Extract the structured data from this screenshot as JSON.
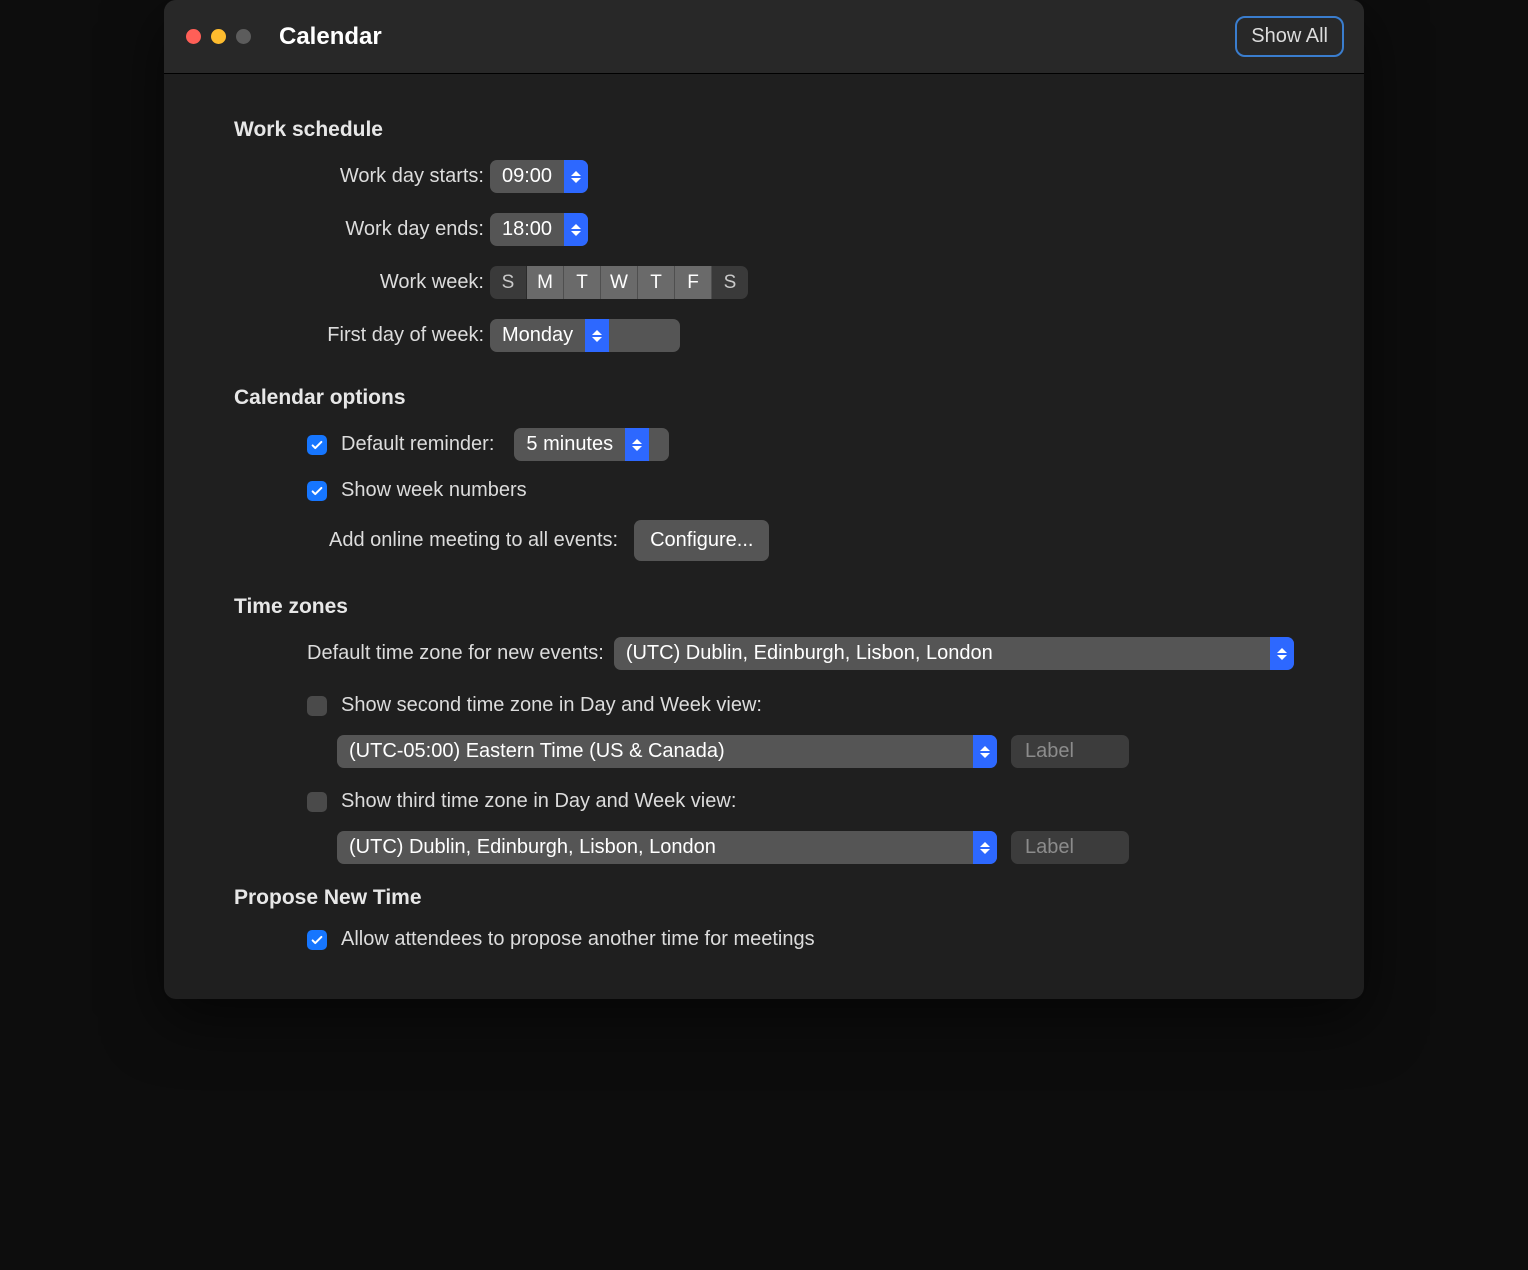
{
  "header": {
    "title": "Calendar",
    "show_all": "Show All"
  },
  "work_schedule": {
    "heading": "Work schedule",
    "starts_label": "Work day starts:",
    "starts_value": "09:00",
    "ends_label": "Work day ends:",
    "ends_value": "18:00",
    "week_label": "Work week:",
    "days": [
      {
        "abbr": "S",
        "on": false
      },
      {
        "abbr": "M",
        "on": true
      },
      {
        "abbr": "T",
        "on": true
      },
      {
        "abbr": "W",
        "on": true
      },
      {
        "abbr": "T",
        "on": true
      },
      {
        "abbr": "F",
        "on": true
      },
      {
        "abbr": "S",
        "on": false
      }
    ],
    "first_day_label": "First day of week:",
    "first_day_value": "Monday"
  },
  "calendar_options": {
    "heading": "Calendar options",
    "default_reminder_label": "Default reminder:",
    "default_reminder_checked": true,
    "default_reminder_value": "5 minutes",
    "week_numbers_label": "Show week numbers",
    "week_numbers_checked": true,
    "online_meeting_label": "Add online meeting to all events:",
    "configure_label": "Configure..."
  },
  "time_zones": {
    "heading": "Time zones",
    "default_label": "Default time zone for new events:",
    "default_value": "(UTC) Dublin, Edinburgh, Lisbon, London",
    "second_label": "Show second time zone in Day and Week view:",
    "second_checked": false,
    "second_value": "(UTC-05:00) Eastern Time (US & Canada)",
    "second_labelbox": "Label",
    "third_label": "Show third time zone in Day and Week view:",
    "third_checked": false,
    "third_value": "(UTC) Dublin, Edinburgh, Lisbon, London",
    "third_labelbox": "Label"
  },
  "propose": {
    "heading": "Propose New Time",
    "allow_label": "Allow attendees to propose another time for meetings",
    "allow_checked": true
  }
}
